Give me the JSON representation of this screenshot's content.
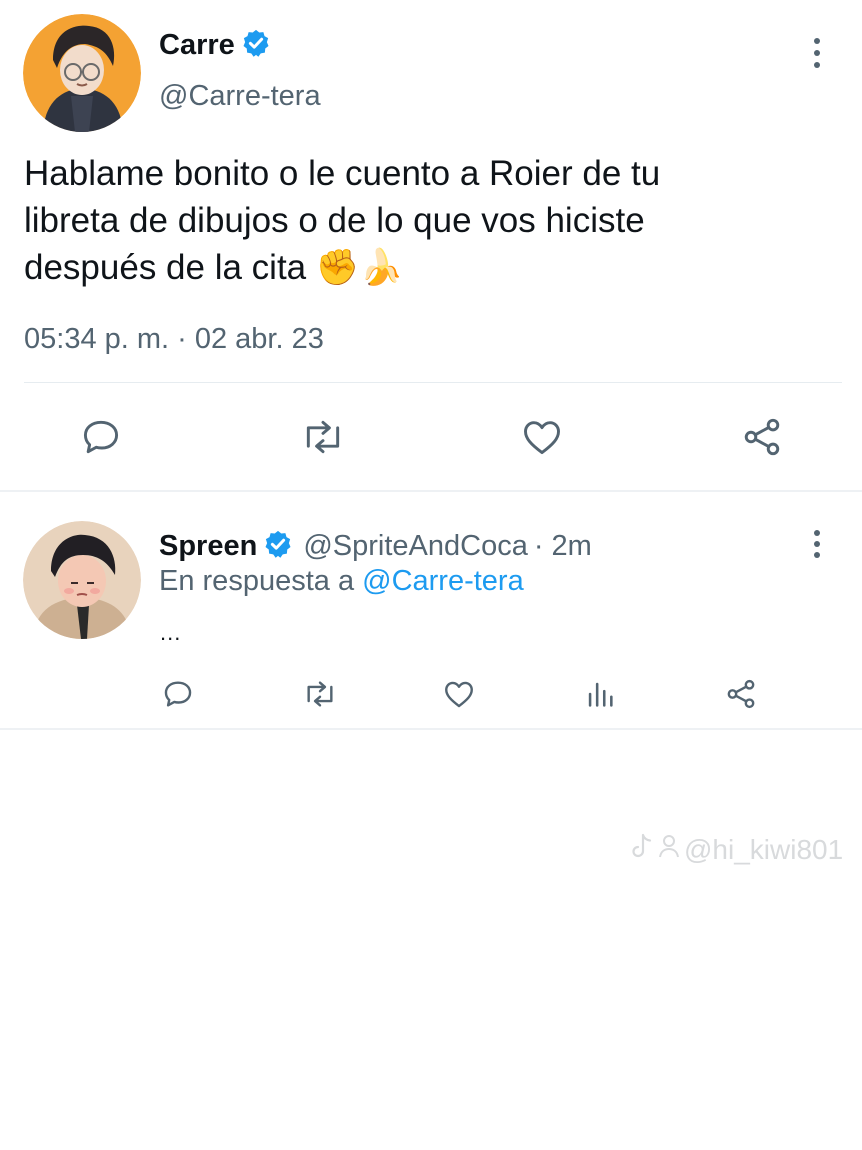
{
  "main_tweet": {
    "author_name": "Carre",
    "author_handle": "@Carre-tera",
    "text_lines": [
      "Hablame bonito o le cuento a Roier de tu",
      "libreta de dibujos o de lo que vos hiciste",
      "después de la cita ✊🍌"
    ],
    "timestamp": "05:34 p. m. · 02 abr. 23",
    "icons": [
      "reply-icon",
      "retweet-icon",
      "like-icon",
      "share-icon"
    ]
  },
  "reply_tweet": {
    "author_name": "Spreen",
    "author_handle": "@SpriteAndCoca",
    "time_ago": "· 2m",
    "replying_prefix": "En respuesta a",
    "replying_handle": "@Carre-tera",
    "text": "...",
    "icons": [
      "reply-icon",
      "retweet-icon",
      "like-icon",
      "analytics-icon",
      "share-icon"
    ]
  },
  "watermark": {
    "text": "@hi_kiwi801"
  },
  "colors": {
    "accent": "#1d9bf0",
    "secondary_text": "#536471",
    "icon": "#536471"
  }
}
